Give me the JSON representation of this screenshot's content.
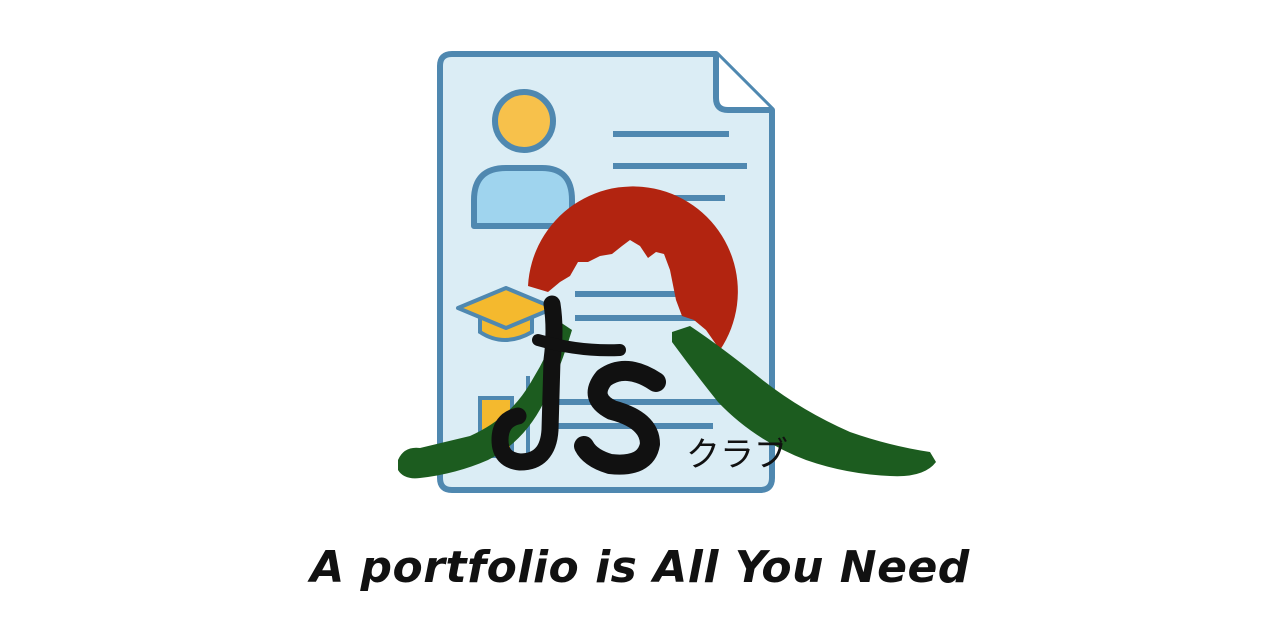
{
  "logo": {
    "js_text": "JS",
    "club_text": "クラブ"
  },
  "headline": "A portfolio is All You Need",
  "colors": {
    "document_fill": "#dbedf5",
    "document_stroke": "#4f88b0",
    "person_head": "#f7c14b",
    "person_body": "#9fd4ee",
    "sun_red": "#b22410",
    "mountain_green": "#1c5c1f",
    "ink_black": "#111111",
    "cap_yellow": "#f4b92e"
  },
  "icons": [
    "document-icon",
    "person-icon",
    "graduation-cap-icon",
    "sun-icon",
    "mountain-icon"
  ]
}
